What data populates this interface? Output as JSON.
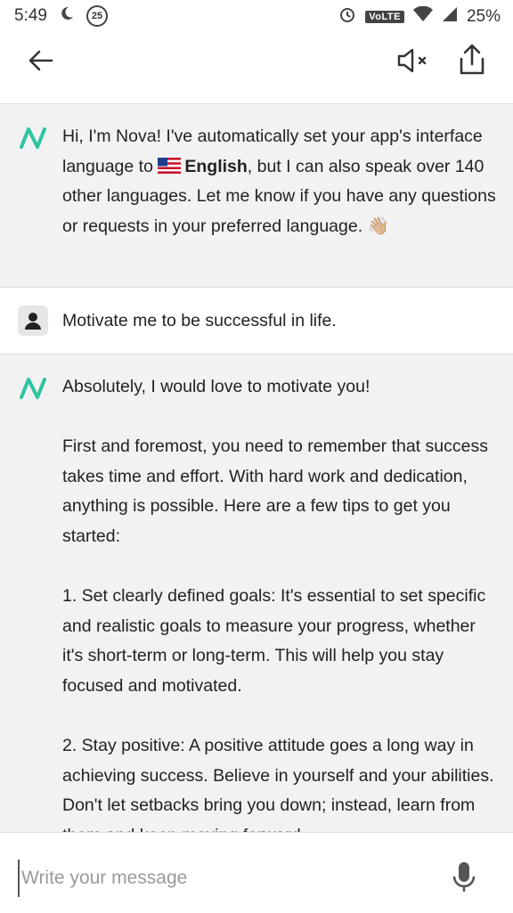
{
  "status_bar": {
    "time": "5:49",
    "notification_badge": "25",
    "network_label": "VoLTE",
    "battery": "25%"
  },
  "app_bar": {
    "icons": [
      "back-arrow-icon",
      "mute-icon",
      "share-icon"
    ]
  },
  "messages": [
    {
      "sender": "bot",
      "pre": "Hi, I'm Nova! I've automatically set your app's interface language to",
      "language": "English",
      "post": ", but I can also speak over 140 other languages. Let me know if you have any questions or requests in your preferred language.",
      "emoji": "👋🏼"
    },
    {
      "sender": "user",
      "text": "Motivate me to be successful in life."
    },
    {
      "sender": "bot",
      "paragraphs": [
        "Absolutely, I would love to motivate you!",
        "First and foremost, you need to remember that success takes time and effort. With hard work and dedication, anything is possible. Here are a few tips to get you started:",
        "1. Set clearly defined goals: It's essential to set specific and realistic goals to measure your progress, whether it's short-term or long-term. This will help you stay focused and motivated.",
        "2. Stay positive: A positive attitude goes a long way in achieving success. Believe in yourself and your abilities. Don't let setbacks bring you down; instead, learn from them and keep moving forward."
      ]
    }
  ],
  "composer": {
    "placeholder": "Write your message"
  },
  "colors": {
    "brand": "#2ec4a0",
    "bot_bg": "#f2f2f2",
    "user_bg": "#ffffff"
  }
}
